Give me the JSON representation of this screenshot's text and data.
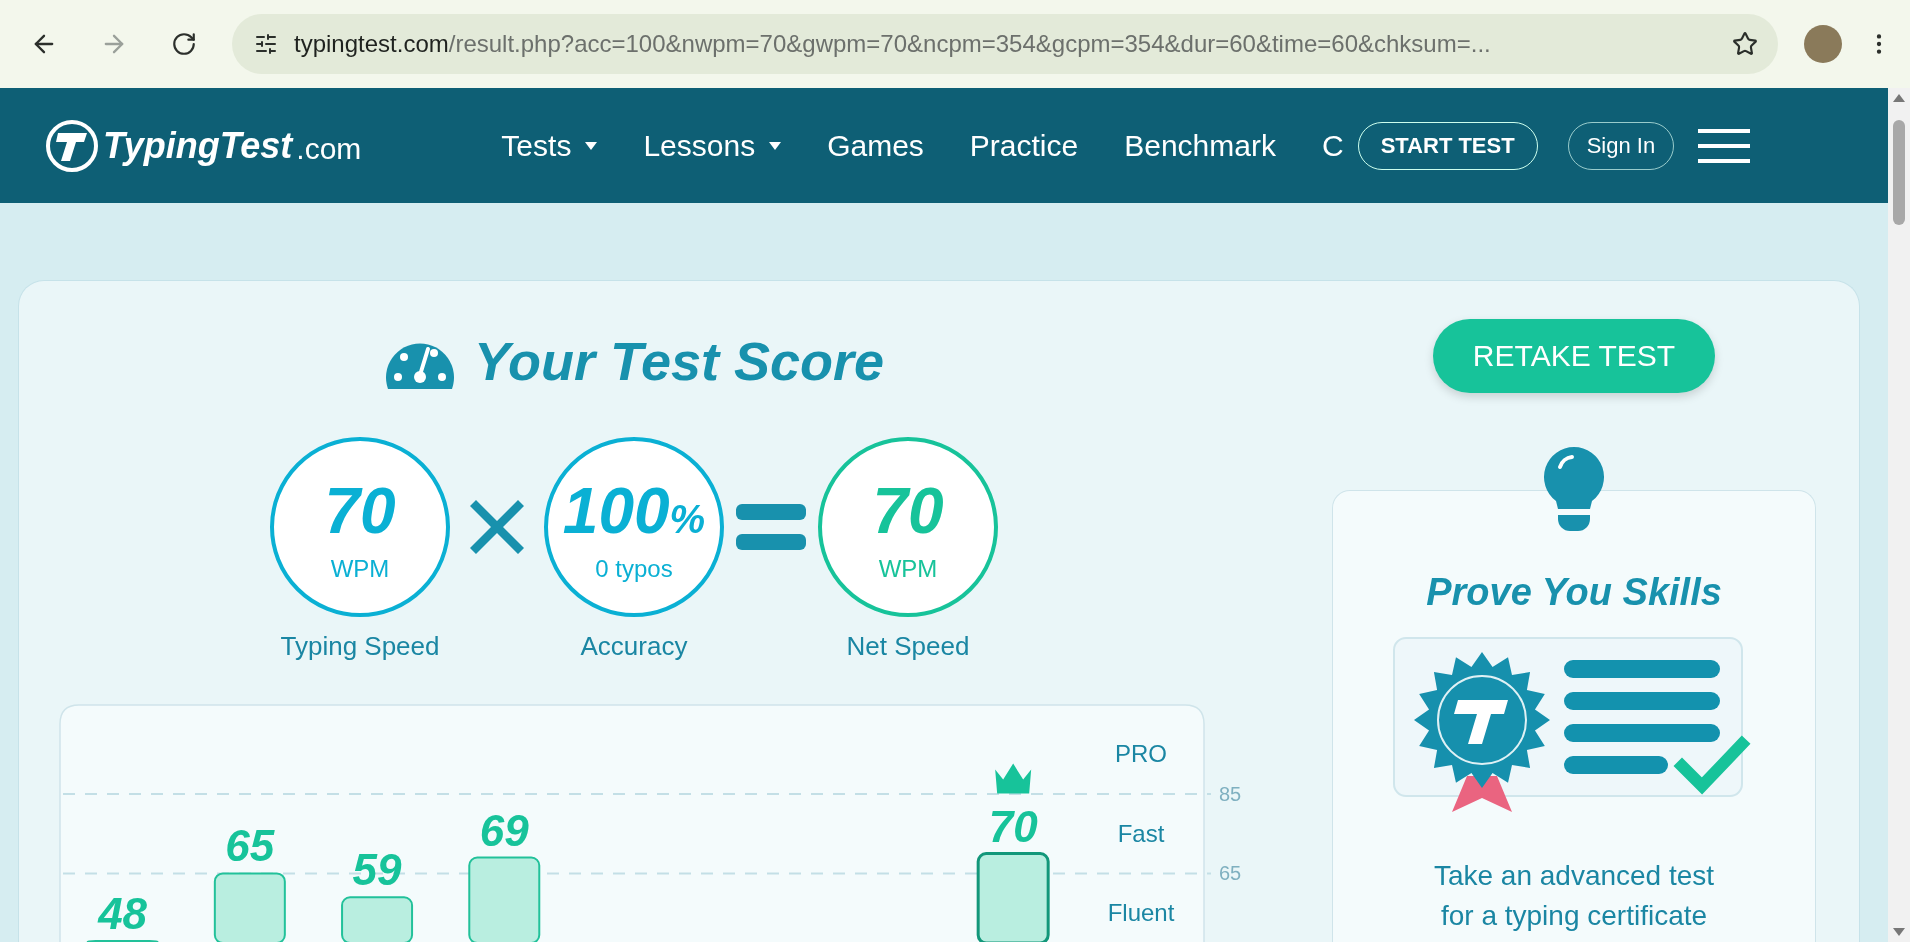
{
  "browser": {
    "url_host": "typingtest.com",
    "url_path": "/result.php?acc=100&nwpm=70&gwpm=70&ncpm=354&gcpm=354&dur=60&time=60&chksum=..."
  },
  "header": {
    "logo": {
      "name": "TypingTest",
      "suffix": ".com"
    },
    "nav": [
      {
        "label": "Tests",
        "has_menu": true
      },
      {
        "label": "Lessons",
        "has_menu": true
      },
      {
        "label": "Games",
        "has_menu": false
      },
      {
        "label": "Practice",
        "has_menu": false
      },
      {
        "label": "Benchmark",
        "has_menu": false
      },
      {
        "label": "C",
        "has_menu": false
      }
    ],
    "start_button": "START TEST",
    "sign_in": "Sign In"
  },
  "score": {
    "title": "Your Test Score",
    "items": [
      {
        "value": "70",
        "unit": "WPM",
        "caption": "Typing Speed",
        "color": "#0ab0d4"
      },
      {
        "value": "100",
        "suffix": "%",
        "unit": "0 typos",
        "caption": "Accuracy",
        "color": "#0ab0d4"
      },
      {
        "value": "70",
        "unit": "WPM",
        "caption": "Net Speed",
        "color": "#17c39a"
      }
    ],
    "operators": [
      {
        "kind": "times"
      },
      {
        "kind": "equals"
      }
    ]
  },
  "chart": {
    "bands": [
      "PRO",
      "Fast",
      "Fluent"
    ],
    "chart_data": {
      "type": "bar",
      "values": [
        48,
        65,
        59,
        69,
        null,
        null,
        null,
        70,
        null
      ],
      "ylim": [
        47.5,
        85
      ],
      "yticks": [
        65,
        85
      ],
      "data_labels": true
    }
  },
  "aside": {
    "retake": "RETAKE TEST",
    "promo": {
      "title": "Prove You Skills",
      "text": "Take an advanced test for a typing certificate"
    }
  }
}
